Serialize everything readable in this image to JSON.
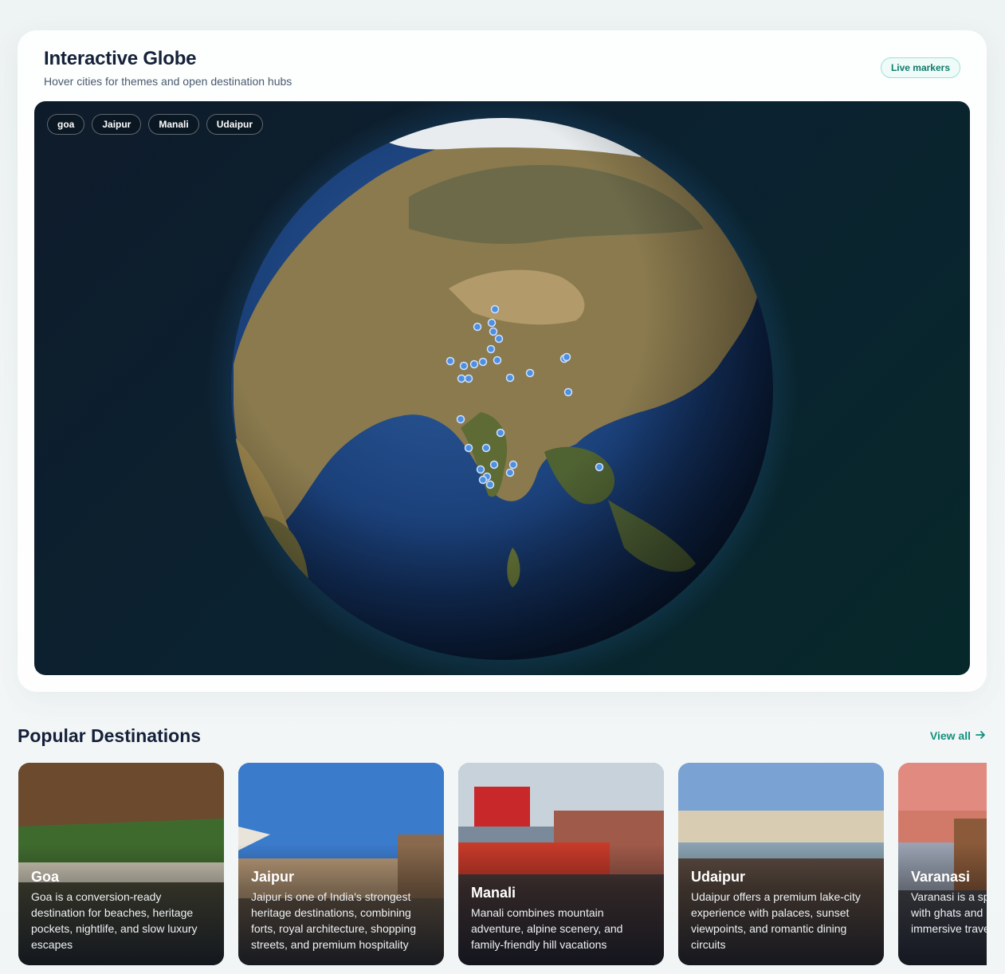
{
  "globe": {
    "title": "Interactive Globe",
    "subtitle": "Hover cities for themes and open destination hubs",
    "badge": "Live markers",
    "chips": [
      "goa",
      "Jaipur",
      "Manali",
      "Udaipur"
    ]
  },
  "destinations": {
    "title": "Popular Destinations",
    "view_all": "View all",
    "cards": [
      {
        "name": "Goa",
        "description": "Goa is a conversion-ready destination for beaches, heritage pockets, nightlife, and slow luxury escapes"
      },
      {
        "name": "Jaipur",
        "description": "Jaipur is one of India's strongest heritage destinations, combining forts, royal architecture, shopping streets, and premium hospitality"
      },
      {
        "name": "Manali",
        "description": "Manali combines mountain adventure, alpine scenery, and family-friendly hill vacations"
      },
      {
        "name": "Udaipur",
        "description": "Udaipur offers a premium lake-city experience with palaces, sunset viewpoints, and romantic dining circuits"
      },
      {
        "name": "Varanasi",
        "description": "Varanasi is a spiritual powerhouse with ghats and local life creating immersive travel"
      }
    ]
  },
  "colors": {
    "accent": "#11917e",
    "ocean": "#1a3f78",
    "land": "#8a7a4e",
    "marker": "#4f8fe0"
  }
}
